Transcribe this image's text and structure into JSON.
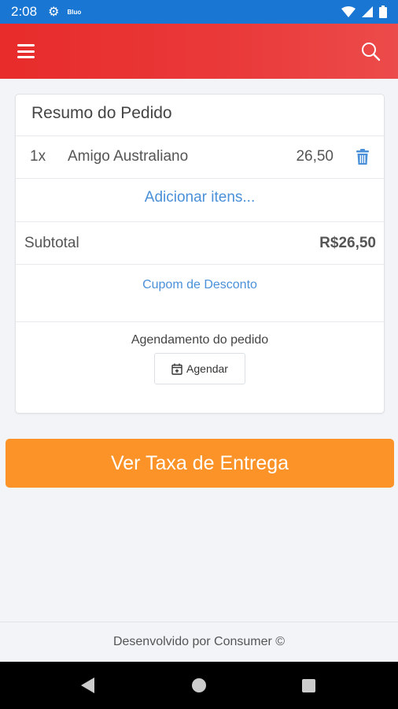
{
  "status_bar": {
    "time": "2:08",
    "note": "Bluo"
  },
  "app_bar": {
    "menu_icon": "hamburger-menu-icon",
    "search_icon": "search-icon",
    "color": "#e82b2b"
  },
  "order_summary": {
    "title": "Resumo do Pedido",
    "items": [
      {
        "qty": "1x",
        "name": "Amigo Australiano",
        "price": "26,50"
      }
    ],
    "add_items_label": "Adicionar itens...",
    "subtotal_label": "Subtotal",
    "subtotal_value": "R$26,50",
    "coupon_label": "Cupom de Desconto",
    "schedule_title": "Agendamento do pedido",
    "schedule_button_label": "Agendar"
  },
  "cta": {
    "label": "Ver Taxa de Entrega",
    "color": "#fb9329"
  },
  "footer": {
    "text": "Desenvolvido por Consumer ©"
  },
  "colors": {
    "link": "#4a90d9",
    "status_bar": "#1976d2",
    "background": "#f2f4f8"
  }
}
